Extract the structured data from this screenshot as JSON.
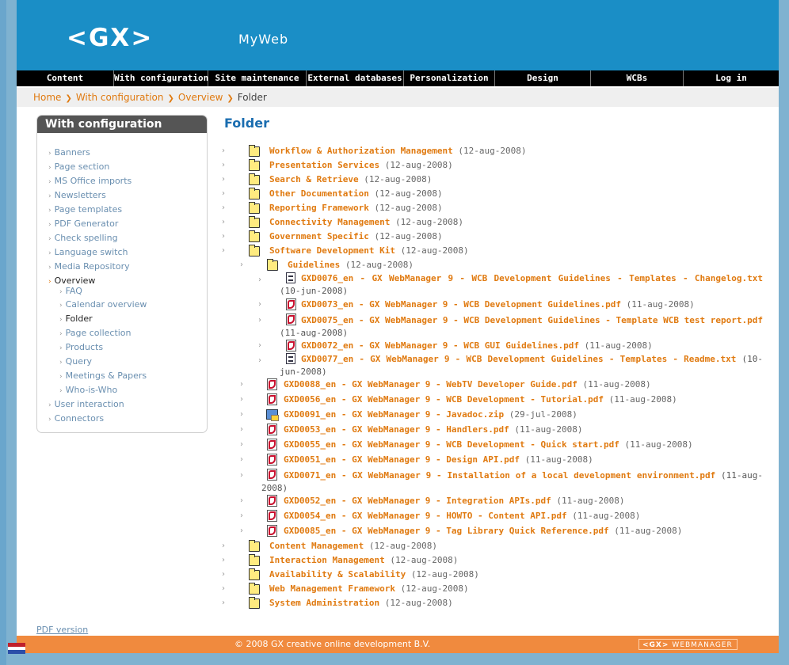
{
  "header": {
    "logo": "<GX>",
    "site_name": "MyWeb"
  },
  "nav": [
    "Content",
    "With configuration",
    "Site maintenance",
    "External databases",
    "Personalization",
    "Design",
    "WCBs",
    "Log in"
  ],
  "breadcrumb": [
    "Home",
    "With configuration",
    "Overview",
    "Folder"
  ],
  "sidebar": {
    "title": "With configuration",
    "items": [
      "Banners",
      "Page section",
      "MS Office imports",
      "Newsletters",
      "Page templates",
      "PDF Generator",
      "Check spelling",
      "Language switch",
      "Media Repository",
      "Overview"
    ],
    "overview_children": [
      "FAQ",
      "Calendar overview",
      "Folder",
      "Page collection",
      "Products",
      "Query",
      "Meetings & Papers",
      "Who-is-Who"
    ],
    "after_items": [
      "User interaction",
      "Connectors"
    ]
  },
  "main": {
    "title": "Folder"
  },
  "tree": {
    "folders_top": [
      {
        "name": "Workflow & Authorization Management",
        "date": "(12-aug-2008)"
      },
      {
        "name": "Presentation Services",
        "date": "(12-aug-2008)"
      },
      {
        "name": "Search & Retrieve",
        "date": "(12-aug-2008)"
      },
      {
        "name": "Other Documentation",
        "date": "(12-aug-2008)"
      },
      {
        "name": "Reporting Framework",
        "date": "(12-aug-2008)"
      },
      {
        "name": "Connectivity Management",
        "date": "(12-aug-2008)"
      },
      {
        "name": "Government Specific",
        "date": "(12-aug-2008)"
      },
      {
        "name": "Software Development Kit",
        "date": "(12-aug-2008)"
      }
    ],
    "guidelines": {
      "name": "Guidelines",
      "date": "(12-aug-2008)"
    },
    "guideline_files": [
      {
        "name": "GXD0076_en - GX WebManager 9 - WCB Development Guidelines - Templates - Changelog.txt",
        "date": "(10-jun-2008)",
        "icon": "text-file-icon"
      },
      {
        "name": "GXD0073_en - GX WebManager 9 - WCB Development Guidelines.pdf",
        "date": "(11-aug-2008)",
        "icon": "pdf-file-icon"
      },
      {
        "name": "GXD0075_en - GX WebManager 9 - WCB Development Guidelines - Template WCB test report.pdf",
        "date": "(11-aug-2008)",
        "icon": "pdf-file-icon"
      },
      {
        "name": "GXD0072_en - GX WebManager 9 - WCB GUI Guidelines.pdf",
        "date": "(11-aug-2008)",
        "icon": "pdf-file-icon"
      },
      {
        "name": "GXD0077_en - GX WebManager 9 - WCB Development Guidelines - Templates - Readme.txt",
        "date": "(10-jun-2008)",
        "icon": "text-file-icon"
      }
    ],
    "sdk_files": [
      {
        "name": "GXD0088_en - GX WebManager 9 - WebTV Developer Guide.pdf",
        "date": "(11-aug-2008)",
        "icon": "pdf-file-icon"
      },
      {
        "name": "GXD0056_en - GX WebManager 9 - WCB Development - Tutorial.pdf",
        "date": "(11-aug-2008)",
        "icon": "pdf-file-icon"
      },
      {
        "name": "GXD0091_en - GX WebManager 9 - Javadoc.zip",
        "date": "(29-jul-2008)",
        "icon": "zip-file-icon"
      },
      {
        "name": "GXD0053_en - GX WebManager 9 - Handlers.pdf",
        "date": "(11-aug-2008)",
        "icon": "pdf-file-icon"
      },
      {
        "name": "GXD0055_en - GX WebManager 9 - WCB Development - Quick start.pdf",
        "date": "(11-aug-2008)",
        "icon": "pdf-file-icon"
      },
      {
        "name": "GXD0051_en - GX WebManager 9 - Design API.pdf",
        "date": "(11-aug-2008)",
        "icon": "pdf-file-icon"
      },
      {
        "name": "GXD0071_en - GX WebManager 9 - Installation of a local development environment.pdf",
        "date": "(11-aug-2008)",
        "icon": "pdf-file-icon"
      },
      {
        "name": "GXD0052_en - GX WebManager 9 - Integration APIs.pdf",
        "date": "(11-aug-2008)",
        "icon": "pdf-file-icon"
      },
      {
        "name": "GXD0054_en - GX WebManager 9 - HOWTO - Content API.pdf",
        "date": "(11-aug-2008)",
        "icon": "pdf-file-icon"
      },
      {
        "name": "GXD0085_en - GX WebManager 9 - Tag Library Quick Reference.pdf",
        "date": "(11-aug-2008)",
        "icon": "pdf-file-icon"
      }
    ],
    "folders_bottom": [
      {
        "name": "Content Management",
        "date": "(12-aug-2008)"
      },
      {
        "name": "Interaction Management",
        "date": "(12-aug-2008)"
      },
      {
        "name": "Availability & Scalability",
        "date": "(12-aug-2008)"
      },
      {
        "name": "Web Management Framework",
        "date": "(12-aug-2008)"
      },
      {
        "name": "System Administration",
        "date": "(12-aug-2008)"
      }
    ]
  },
  "pdf_version_label": "PDF version",
  "footer": {
    "copyright": "© 2008 GX creative online development B.V.",
    "logo_gx": "<GX>",
    "logo_text": "WEBMANAGER"
  },
  "colors": {
    "header_blue": "#1a8ec6",
    "link_orange": "#e07a10",
    "footer_orange": "#f08a3e"
  }
}
